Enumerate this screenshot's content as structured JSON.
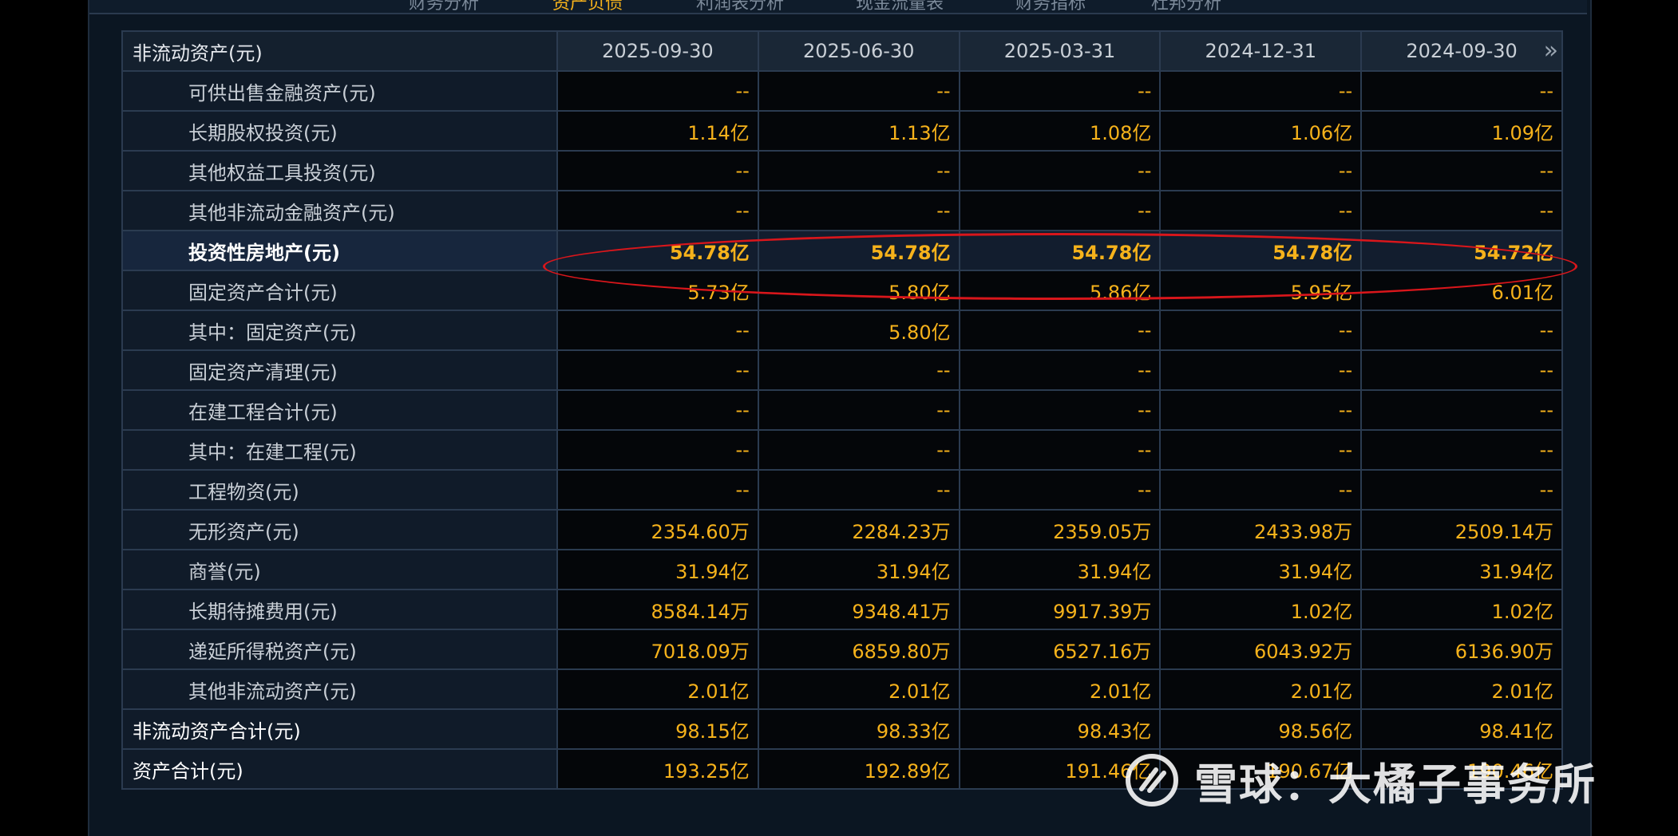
{
  "top_tabs": [
    {
      "label": "财务分析",
      "active": false
    },
    {
      "label": "资产负债",
      "active": true
    },
    {
      "label": "利润表分析",
      "active": false
    },
    {
      "label": "现金流量表",
      "active": false
    },
    {
      "label": "财务指标",
      "active": false
    },
    {
      "label": "杜邦分析",
      "active": false
    }
  ],
  "table": {
    "header_label": "非流动资产(元)",
    "dates": [
      "2025-09-30",
      "2025-06-30",
      "2025-03-31",
      "2024-12-31",
      "2024-09-30"
    ],
    "more_glyph": "»",
    "rows": [
      {
        "label": "可供出售金融资产(元)",
        "values": [
          "--",
          "--",
          "--",
          "--",
          "--"
        ]
      },
      {
        "label": "长期股权投资(元)",
        "values": [
          "1.14亿",
          "1.13亿",
          "1.08亿",
          "1.06亿",
          "1.09亿"
        ]
      },
      {
        "label": "其他权益工具投资(元)",
        "values": [
          "--",
          "--",
          "--",
          "--",
          "--"
        ]
      },
      {
        "label": "其他非流动金融资产(元)",
        "values": [
          "--",
          "--",
          "--",
          "--",
          "--"
        ]
      },
      {
        "label": "投资性房地产(元)",
        "values": [
          "54.78亿",
          "54.78亿",
          "54.78亿",
          "54.78亿",
          "54.72亿"
        ],
        "highlight": true
      },
      {
        "label": "固定资产合计(元)",
        "values": [
          "5.73亿",
          "5.80亿",
          "5.86亿",
          "5.95亿",
          "6.01亿"
        ]
      },
      {
        "label": "其中：固定资产(元)",
        "values": [
          "--",
          "5.80亿",
          "--",
          "--",
          "--"
        ]
      },
      {
        "label": "固定资产清理(元)",
        "values": [
          "--",
          "--",
          "--",
          "--",
          "--"
        ]
      },
      {
        "label": "在建工程合计(元)",
        "values": [
          "--",
          "--",
          "--",
          "--",
          "--"
        ]
      },
      {
        "label": "其中：在建工程(元)",
        "values": [
          "--",
          "--",
          "--",
          "--",
          "--"
        ]
      },
      {
        "label": "工程物资(元)",
        "values": [
          "--",
          "--",
          "--",
          "--",
          "--"
        ]
      },
      {
        "label": "无形资产(元)",
        "values": [
          "2354.60万",
          "2284.23万",
          "2359.05万",
          "2433.98万",
          "2509.14万"
        ]
      },
      {
        "label": "商誉(元)",
        "values": [
          "31.94亿",
          "31.94亿",
          "31.94亿",
          "31.94亿",
          "31.94亿"
        ]
      },
      {
        "label": "长期待摊费用(元)",
        "values": [
          "8584.14万",
          "9348.41万",
          "9917.39万",
          "1.02亿",
          "1.02亿"
        ]
      },
      {
        "label": "递延所得税资产(元)",
        "values": [
          "7018.09万",
          "6859.80万",
          "6527.16万",
          "6043.92万",
          "6136.90万"
        ]
      },
      {
        "label": "其他非流动资产(元)",
        "values": [
          "2.01亿",
          "2.01亿",
          "2.01亿",
          "2.01亿",
          "2.01亿"
        ]
      },
      {
        "label": "非流动资产合计(元)",
        "values": [
          "98.15亿",
          "98.33亿",
          "98.43亿",
          "98.56亿",
          "98.41亿"
        ],
        "total": true
      },
      {
        "label": "资产合计(元)",
        "values": [
          "193.25亿",
          "192.89亿",
          "191.46亿",
          "190.67亿",
          "190.46亿"
        ],
        "total": true
      }
    ]
  },
  "watermark": {
    "text": "雪球：大橘子事务所"
  },
  "colors": {
    "value_text": "#f6b21b",
    "annotation": "#d9161b",
    "header_bg": "#1a2736",
    "label_bg": "#101b29",
    "value_bg": "#040609"
  }
}
